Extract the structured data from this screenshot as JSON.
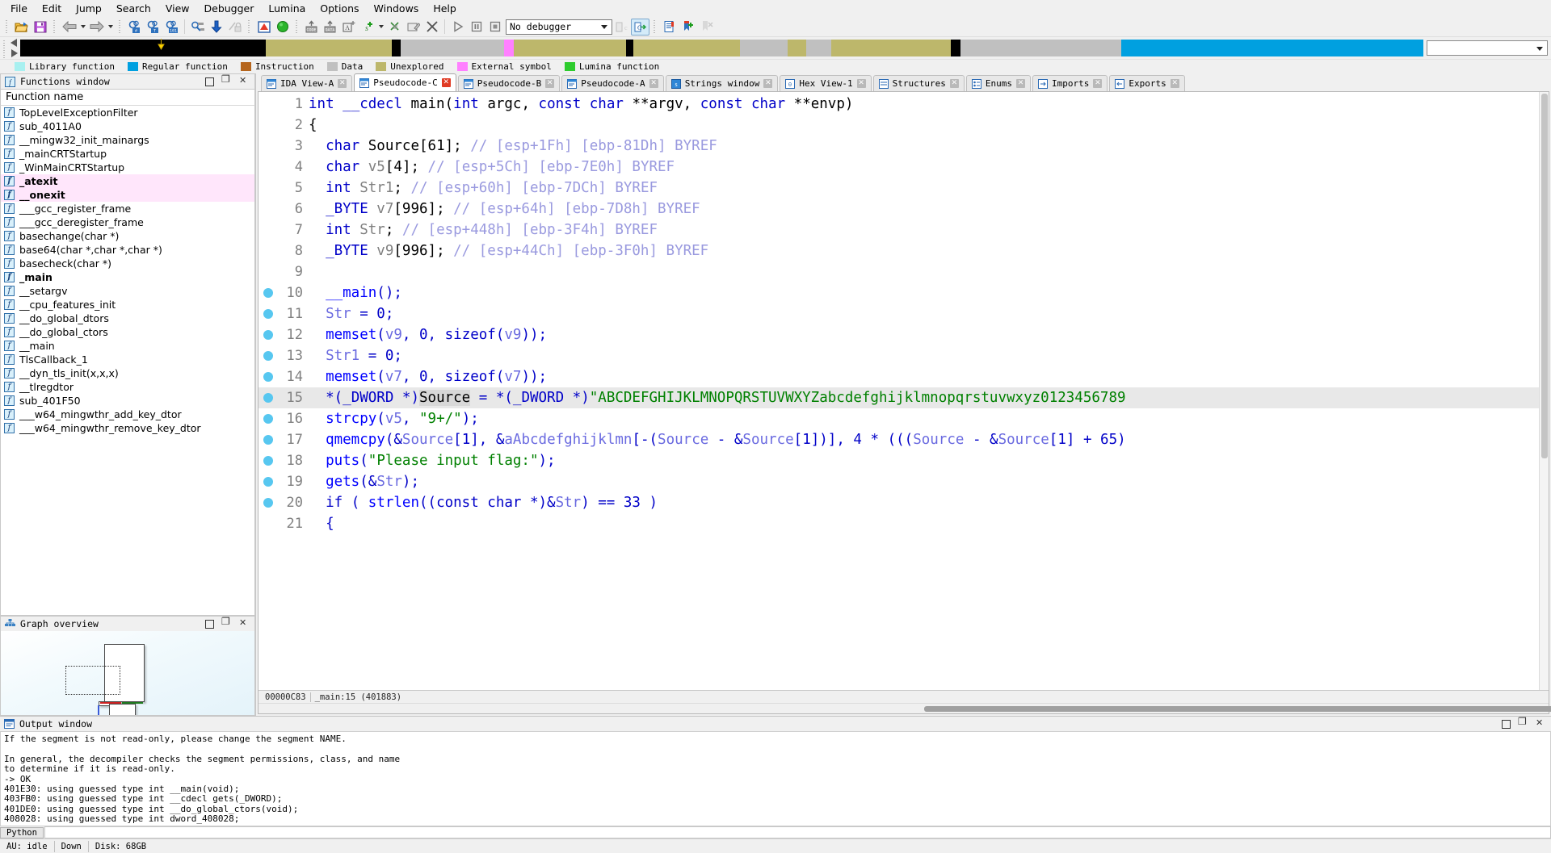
{
  "menubar": {
    "items": [
      "File",
      "Edit",
      "Jump",
      "Search",
      "View",
      "Debugger",
      "Lumina",
      "Options",
      "Windows",
      "Help"
    ]
  },
  "toolbar": {
    "debugger_selected": "No debugger",
    "icons": [
      "open-file-icon",
      "save-icon",
      "back-arrow-icon",
      "back-dropdown-icon",
      "forward-arrow-icon",
      "forward-dropdown-icon",
      "search-hex-icon",
      "search-text-icon",
      "search-binary-icon",
      "jump-icon",
      "download-icon",
      "no-lock-icon",
      "warning-icon",
      "green-circle-icon",
      "make-code-icon",
      "make-data-icon",
      "make-ascii-icon",
      "make-struct-icon",
      "struct-dropdown-icon",
      "undefine-icon",
      "edit-func-icon",
      "delete-icon",
      "run-icon",
      "pause-icon",
      "stop-icon",
      "decompile-c-icon",
      "decompile-arrow-icon",
      "list-icon",
      "add-bookmark-icon",
      "remove-bookmark-icon"
    ]
  },
  "navband": {
    "segments": [
      {
        "color": "#00a0e0",
        "width": 21.5
      },
      {
        "color": "#c0c0c0",
        "width": 11.5
      },
      {
        "color": "#000000",
        "width": 0.7
      },
      {
        "color": "#bdb76b",
        "width": 8.5
      },
      {
        "color": "#c0c0c0",
        "width": 1.8
      },
      {
        "color": "#bdb76b",
        "width": 1.3
      },
      {
        "color": "#c0c0c0",
        "width": 3.4
      },
      {
        "color": "#bdb76b",
        "width": 7.6
      },
      {
        "color": "#000000",
        "width": 0.5
      },
      {
        "color": "#bdb76b",
        "width": 8.0
      },
      {
        "color": "#ff80ff",
        "width": 0.7
      },
      {
        "color": "#c0c0c0",
        "width": 7.4
      },
      {
        "color": "#000000",
        "width": 0.6
      },
      {
        "color": "#bdb76b",
        "width": 9.0
      },
      {
        "color": "#000000",
        "width": 17.5
      }
    ]
  },
  "legend": {
    "items": [
      {
        "label": "Library function",
        "color": "#a8f0f0"
      },
      {
        "label": "Regular function",
        "color": "#00a0e0"
      },
      {
        "label": "Instruction",
        "color": "#b5651d"
      },
      {
        "label": "Data",
        "color": "#c0c0c0"
      },
      {
        "label": "Unexplored",
        "color": "#bdb76b"
      },
      {
        "label": "External symbol",
        "color": "#ff80ff"
      },
      {
        "label": "Lumina function",
        "color": "#2ecc2e"
      }
    ]
  },
  "functions_window": {
    "title": "Functions window",
    "column_header": "Function name",
    "items": [
      {
        "name": "TopLevelExceptionFilter",
        "highlight": false,
        "bold": false
      },
      {
        "name": "sub_4011A0",
        "highlight": false,
        "bold": false
      },
      {
        "name": "__mingw32_init_mainargs",
        "highlight": false,
        "bold": false
      },
      {
        "name": "_mainCRTStartup",
        "highlight": false,
        "bold": false
      },
      {
        "name": "_WinMainCRTStartup",
        "highlight": false,
        "bold": false
      },
      {
        "name": "_atexit",
        "highlight": true,
        "bold": true
      },
      {
        "name": "__onexit",
        "highlight": true,
        "bold": true
      },
      {
        "name": "___gcc_register_frame",
        "highlight": false,
        "bold": false
      },
      {
        "name": "___gcc_deregister_frame",
        "highlight": false,
        "bold": false
      },
      {
        "name": "basechange(char *)",
        "highlight": false,
        "bold": false
      },
      {
        "name": "base64(char *,char *,char *)",
        "highlight": false,
        "bold": false
      },
      {
        "name": "basecheck(char *)",
        "highlight": false,
        "bold": false
      },
      {
        "name": "_main",
        "highlight": false,
        "bold": true
      },
      {
        "name": "__setargv",
        "highlight": false,
        "bold": false
      },
      {
        "name": "__cpu_features_init",
        "highlight": false,
        "bold": false
      },
      {
        "name": "__do_global_dtors",
        "highlight": false,
        "bold": false
      },
      {
        "name": "__do_global_ctors",
        "highlight": false,
        "bold": false
      },
      {
        "name": "__main",
        "highlight": false,
        "bold": false
      },
      {
        "name": "TlsCallback_1",
        "highlight": false,
        "bold": false
      },
      {
        "name": "__dyn_tls_init(x,x,x)",
        "highlight": false,
        "bold": false
      },
      {
        "name": "__tlregdtor",
        "highlight": false,
        "bold": false
      },
      {
        "name": "sub_401F50",
        "highlight": false,
        "bold": false
      },
      {
        "name": "___w64_mingwthr_add_key_dtor",
        "highlight": false,
        "bold": false
      },
      {
        "name": "___w64_mingwthr_remove_key_dtor",
        "highlight": false,
        "bold": false
      }
    ]
  },
  "graph_overview": {
    "title": "Graph overview"
  },
  "tabs": [
    {
      "label": "IDA View-A",
      "selected": false,
      "icon": "ida-view-icon"
    },
    {
      "label": "Pseudocode-C",
      "selected": true,
      "icon": "pseudocode-icon"
    },
    {
      "label": "Pseudocode-B",
      "selected": false,
      "icon": "pseudocode-icon"
    },
    {
      "label": "Pseudocode-A",
      "selected": false,
      "icon": "pseudocode-icon"
    },
    {
      "label": "Strings window",
      "selected": false,
      "icon": "strings-icon"
    },
    {
      "label": "Hex View-1",
      "selected": false,
      "icon": "hex-icon"
    },
    {
      "label": "Structures",
      "selected": false,
      "icon": "structures-icon"
    },
    {
      "label": "Enums",
      "selected": false,
      "icon": "enums-icon"
    },
    {
      "label": "Imports",
      "selected": false,
      "icon": "imports-icon"
    },
    {
      "label": "Exports",
      "selected": false,
      "icon": "exports-icon"
    }
  ],
  "pseudocode": {
    "current_line": 15,
    "status": {
      "offset": "00000C83",
      "location": "_main:15 (401883)"
    },
    "lines": [
      {
        "n": 1,
        "bp": false,
        "tokens": [
          {
            "t": "int ",
            "c": "kw"
          },
          {
            "t": "__cdecl ",
            "c": "kw"
          },
          {
            "t": "main",
            "c": "id"
          },
          {
            "t": "(",
            "c": "id"
          },
          {
            "t": "int ",
            "c": "kw"
          },
          {
            "t": "argc",
            "c": "id"
          },
          {
            "t": ", ",
            "c": "id"
          },
          {
            "t": "const char ",
            "c": "kw"
          },
          {
            "t": "**argv",
            "c": "id"
          },
          {
            "t": ", ",
            "c": "id"
          },
          {
            "t": "const char ",
            "c": "kw"
          },
          {
            "t": "**envp",
            "c": "id"
          },
          {
            "t": ")",
            "c": "id"
          }
        ]
      },
      {
        "n": 2,
        "bp": false,
        "tokens": [
          {
            "t": "{",
            "c": "id"
          }
        ]
      },
      {
        "n": 3,
        "bp": false,
        "tokens": [
          {
            "t": "  ",
            "c": "id"
          },
          {
            "t": "char ",
            "c": "kw"
          },
          {
            "t": "Source",
            "c": "id"
          },
          {
            "t": "[",
            "c": "id"
          },
          {
            "t": "61",
            "c": "num"
          },
          {
            "t": "]; ",
            "c": "id"
          },
          {
            "t": "// [esp+1Fh] [ebp-81Dh] BYREF",
            "c": "cmt"
          }
        ]
      },
      {
        "n": 4,
        "bp": false,
        "tokens": [
          {
            "t": "  ",
            "c": "id"
          },
          {
            "t": "char ",
            "c": "kw"
          },
          {
            "t": "v5",
            "c": "gry"
          },
          {
            "t": "[",
            "c": "id"
          },
          {
            "t": "4",
            "c": "num"
          },
          {
            "t": "]; ",
            "c": "id"
          },
          {
            "t": "// [esp+5Ch] [ebp-7E0h] BYREF",
            "c": "cmt"
          }
        ]
      },
      {
        "n": 5,
        "bp": false,
        "tokens": [
          {
            "t": "  ",
            "c": "id"
          },
          {
            "t": "int ",
            "c": "kw"
          },
          {
            "t": "Str1",
            "c": "gry"
          },
          {
            "t": "; ",
            "c": "id"
          },
          {
            "t": "// [esp+60h] [ebp-7DCh] BYREF",
            "c": "cmt"
          }
        ]
      },
      {
        "n": 6,
        "bp": false,
        "tokens": [
          {
            "t": "  ",
            "c": "id"
          },
          {
            "t": "_BYTE ",
            "c": "kw"
          },
          {
            "t": "v7",
            "c": "gry"
          },
          {
            "t": "[",
            "c": "id"
          },
          {
            "t": "996",
            "c": "num"
          },
          {
            "t": "]; ",
            "c": "id"
          },
          {
            "t": "// [esp+64h] [ebp-7D8h] BYREF",
            "c": "cmt"
          }
        ]
      },
      {
        "n": 7,
        "bp": false,
        "tokens": [
          {
            "t": "  ",
            "c": "id"
          },
          {
            "t": "int ",
            "c": "kw"
          },
          {
            "t": "Str",
            "c": "gry"
          },
          {
            "t": "; ",
            "c": "id"
          },
          {
            "t": "// [esp+448h] [ebp-3F4h] BYREF",
            "c": "cmt"
          }
        ]
      },
      {
        "n": 8,
        "bp": false,
        "tokens": [
          {
            "t": "  ",
            "c": "id"
          },
          {
            "t": "_BYTE ",
            "c": "kw"
          },
          {
            "t": "v9",
            "c": "gry"
          },
          {
            "t": "[",
            "c": "id"
          },
          {
            "t": "996",
            "c": "num"
          },
          {
            "t": "]; ",
            "c": "id"
          },
          {
            "t": "// [esp+44Ch] [ebp-3F0h] BYREF",
            "c": "cmt"
          }
        ]
      },
      {
        "n": 9,
        "bp": false,
        "tokens": []
      },
      {
        "n": 10,
        "bp": true,
        "tokens": [
          {
            "t": "  ",
            "c": "id"
          },
          {
            "t": "__main",
            "c": "fn"
          },
          {
            "t": "();",
            "c": "kw"
          }
        ]
      },
      {
        "n": 11,
        "bp": true,
        "tokens": [
          {
            "t": "  ",
            "c": "id"
          },
          {
            "t": "Str",
            "c": "var"
          },
          {
            "t": " = ",
            "c": "kw"
          },
          {
            "t": "0",
            "c": "kw"
          },
          {
            "t": ";",
            "c": "kw"
          }
        ]
      },
      {
        "n": 12,
        "bp": true,
        "tokens": [
          {
            "t": "  ",
            "c": "id"
          },
          {
            "t": "memset",
            "c": "fn"
          },
          {
            "t": "(",
            "c": "kw"
          },
          {
            "t": "v9",
            "c": "var"
          },
          {
            "t": ", ",
            "c": "kw"
          },
          {
            "t": "0",
            "c": "kw"
          },
          {
            "t": ", ",
            "c": "kw"
          },
          {
            "t": "sizeof",
            "c": "kw"
          },
          {
            "t": "(",
            "c": "kw"
          },
          {
            "t": "v9",
            "c": "var"
          },
          {
            "t": "));",
            "c": "kw"
          }
        ]
      },
      {
        "n": 13,
        "bp": true,
        "tokens": [
          {
            "t": "  ",
            "c": "id"
          },
          {
            "t": "Str1",
            "c": "var"
          },
          {
            "t": " = ",
            "c": "kw"
          },
          {
            "t": "0",
            "c": "kw"
          },
          {
            "t": ";",
            "c": "kw"
          }
        ]
      },
      {
        "n": 14,
        "bp": true,
        "tokens": [
          {
            "t": "  ",
            "c": "id"
          },
          {
            "t": "memset",
            "c": "fn"
          },
          {
            "t": "(",
            "c": "kw"
          },
          {
            "t": "v7",
            "c": "var"
          },
          {
            "t": ", ",
            "c": "kw"
          },
          {
            "t": "0",
            "c": "kw"
          },
          {
            "t": ", ",
            "c": "kw"
          },
          {
            "t": "sizeof",
            "c": "kw"
          },
          {
            "t": "(",
            "c": "kw"
          },
          {
            "t": "v7",
            "c": "var"
          },
          {
            "t": "));",
            "c": "kw"
          }
        ]
      },
      {
        "n": 15,
        "bp": true,
        "current": true,
        "tokens": [
          {
            "t": "  *(",
            "c": "kw"
          },
          {
            "t": "_DWORD ",
            "c": "kw"
          },
          {
            "t": "*)",
            "c": "kw"
          },
          {
            "t": "Source",
            "c": "hlvar"
          },
          {
            "t": " = *(",
            "c": "kw"
          },
          {
            "t": "_DWORD ",
            "c": "kw"
          },
          {
            "t": "*)",
            "c": "kw"
          },
          {
            "t": "\"ABCDEFGHIJKLMNOPQRSTUVWXYZabcdefghijklmnopqrstuvwxyz0123456789",
            "c": "str"
          }
        ]
      },
      {
        "n": 16,
        "bp": true,
        "tokens": [
          {
            "t": "  ",
            "c": "id"
          },
          {
            "t": "strcpy",
            "c": "fn"
          },
          {
            "t": "(",
            "c": "kw"
          },
          {
            "t": "v5",
            "c": "var"
          },
          {
            "t": ", ",
            "c": "kw"
          },
          {
            "t": "\"9+/\"",
            "c": "str"
          },
          {
            "t": ");",
            "c": "kw"
          }
        ]
      },
      {
        "n": 17,
        "bp": true,
        "tokens": [
          {
            "t": "  ",
            "c": "id"
          },
          {
            "t": "qmemcpy",
            "c": "fn"
          },
          {
            "t": "(&",
            "c": "kw"
          },
          {
            "t": "Source",
            "c": "var"
          },
          {
            "t": "[",
            "c": "kw"
          },
          {
            "t": "1",
            "c": "kw"
          },
          {
            "t": "], &",
            "c": "kw"
          },
          {
            "t": "aAbcdefghijklmn",
            "c": "var"
          },
          {
            "t": "[-(",
            "c": "kw"
          },
          {
            "t": "Source",
            "c": "var"
          },
          {
            "t": " - &",
            "c": "kw"
          },
          {
            "t": "Source",
            "c": "var"
          },
          {
            "t": "[",
            "c": "kw"
          },
          {
            "t": "1",
            "c": "kw"
          },
          {
            "t": "])], ",
            "c": "kw"
          },
          {
            "t": "4",
            "c": "kw"
          },
          {
            "t": " * (((",
            "c": "kw"
          },
          {
            "t": "Source",
            "c": "var"
          },
          {
            "t": " - &",
            "c": "kw"
          },
          {
            "t": "Source",
            "c": "var"
          },
          {
            "t": "[",
            "c": "kw"
          },
          {
            "t": "1",
            "c": "kw"
          },
          {
            "t": "] + ",
            "c": "kw"
          },
          {
            "t": "65",
            "c": "kw"
          },
          {
            "t": ")",
            "c": "kw"
          }
        ]
      },
      {
        "n": 18,
        "bp": true,
        "tokens": [
          {
            "t": "  ",
            "c": "id"
          },
          {
            "t": "puts",
            "c": "fn"
          },
          {
            "t": "(",
            "c": "kw"
          },
          {
            "t": "\"Please input flag:\"",
            "c": "str"
          },
          {
            "t": ");",
            "c": "kw"
          }
        ]
      },
      {
        "n": 19,
        "bp": true,
        "tokens": [
          {
            "t": "  ",
            "c": "id"
          },
          {
            "t": "gets",
            "c": "fn"
          },
          {
            "t": "(&",
            "c": "kw"
          },
          {
            "t": "Str",
            "c": "var"
          },
          {
            "t": ");",
            "c": "kw"
          }
        ]
      },
      {
        "n": 20,
        "bp": true,
        "tokens": [
          {
            "t": "  ",
            "c": "id"
          },
          {
            "t": "if ",
            "c": "kw"
          },
          {
            "t": "( ",
            "c": "kw"
          },
          {
            "t": "strlen",
            "c": "fn"
          },
          {
            "t": "((",
            "c": "kw"
          },
          {
            "t": "const char ",
            "c": "kw"
          },
          {
            "t": "*)&",
            "c": "kw"
          },
          {
            "t": "Str",
            "c": "var"
          },
          {
            "t": ") == ",
            "c": "kw"
          },
          {
            "t": "33",
            "c": "kw"
          },
          {
            "t": " )",
            "c": "kw"
          }
        ]
      },
      {
        "n": 21,
        "bp": false,
        "tokens": [
          {
            "t": "  {",
            "c": "kw"
          }
        ]
      }
    ]
  },
  "output_window": {
    "title": "Output window",
    "text": "If the segment is not read-only, please change the segment NAME.\n\nIn general, the decompiler checks the segment permissions, class, and name\nto determine if it is read-only.\n-> OK\n401E30: using guessed type int __main(void);\n403FB0: using guessed type int __cdecl gets(_DWORD);\n401DE0: using guessed type int __do_global_ctors(void);\n408028: using guessed type int dword_408028;",
    "cli_label": "Python"
  },
  "statusbar": {
    "au": "AU:  idle",
    "state": "Down",
    "disk": "Disk: 68GB"
  }
}
